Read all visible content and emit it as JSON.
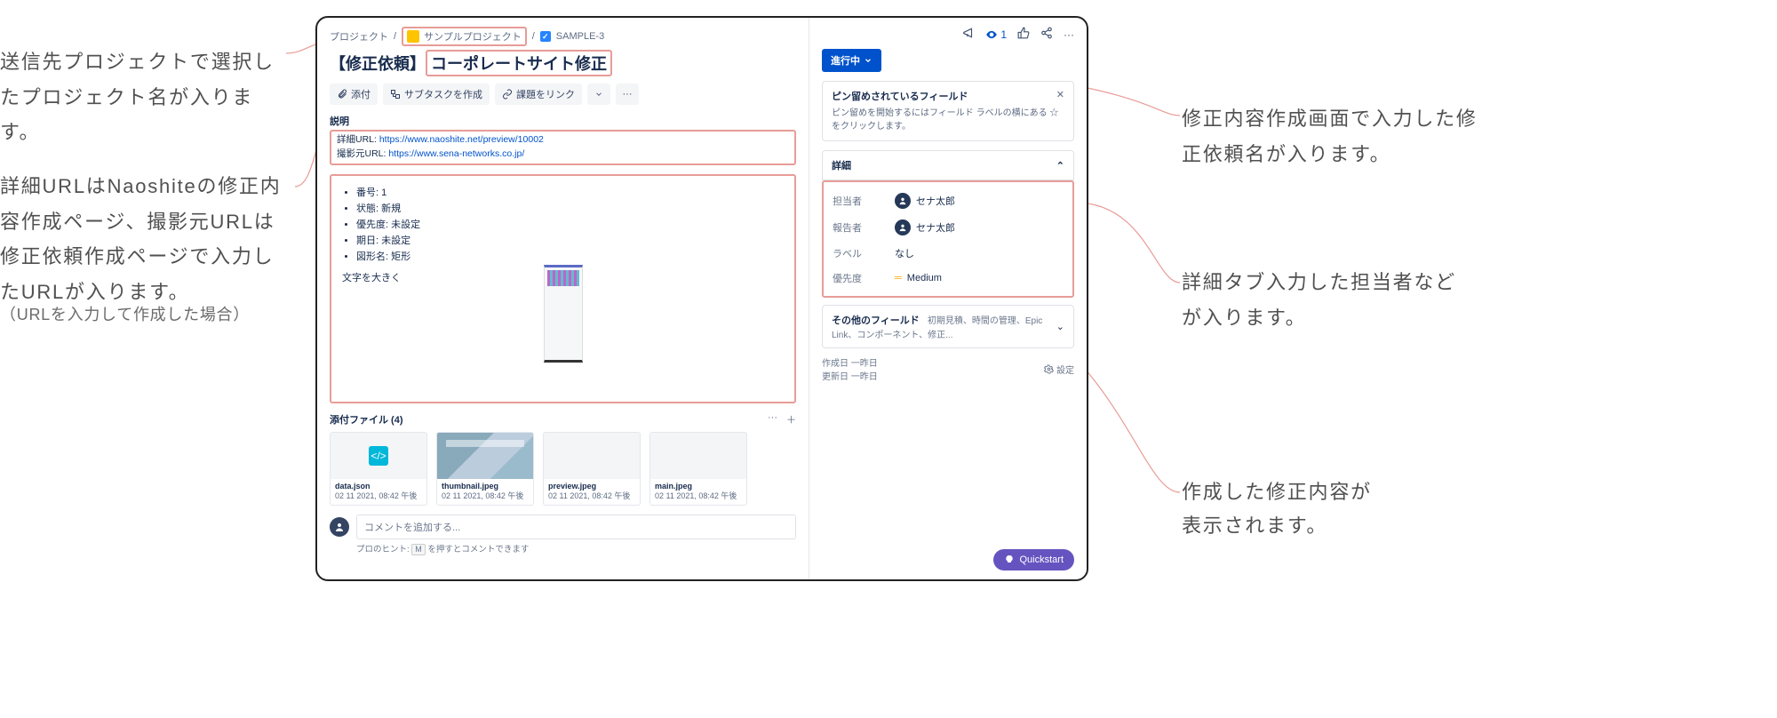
{
  "annotations": {
    "left1": "送信先プロジェクトで選択したプロジェクト名が入ります。",
    "left2a": "詳細URLはNaoshiteの修正内容作成ページ、撮影元URLは修正依頼作成ページで入力したURLが入ります。",
    "left2b": "（URLを入力して作成した場合）",
    "right1": "修正内容作成画面で入力した修正依頼名が入ります。",
    "right2": "詳細タブ入力した担当者などが入ります。",
    "right3a": "作成した修正内容が",
    "right3b": "表示されます。"
  },
  "breadcrumbs": {
    "projects": "プロジェクト",
    "project_name": "サンプルプロジェクト",
    "issue_key": "SAMPLE-3"
  },
  "title": {
    "prefix": "【修正依頼】",
    "name": "コーポレートサイト修正"
  },
  "toolbar": {
    "attach": "添付",
    "subtask": "サブタスクを作成",
    "link": "課題をリンク"
  },
  "desc": {
    "label": "説明",
    "detail_url_label": "詳細URL: ",
    "detail_url": "https://www.naoshite.net/preview/10002",
    "source_url_label": "撮影元URL: ",
    "source_url": "https://www.sena-networks.co.jp/",
    "bullets": {
      "num": "番号: 1",
      "status": "状態: 新規",
      "priority": "優先度: 未設定",
      "due": "期日: 未設定",
      "shape": "図形名: 矩形"
    },
    "enlarge": "文字を大きく"
  },
  "attachments": {
    "header": "添付ファイル (4)",
    "items": [
      {
        "name": "data.json",
        "date": "02 11 2021, 08:42 午後",
        "kind": "json"
      },
      {
        "name": "thumbnail.jpeg",
        "date": "02 11 2021, 08:42 午後",
        "kind": "img"
      },
      {
        "name": "preview.jpeg",
        "date": "02 11 2021, 08:42 午後",
        "kind": "img"
      },
      {
        "name": "main.jpeg",
        "date": "02 11 2021, 08:42 午後",
        "kind": "blank"
      }
    ]
  },
  "comment": {
    "placeholder": "コメントを追加する...",
    "tip_prefix": "プロのヒント: ",
    "tip_key": "M",
    "tip_suffix": " を押すとコメントできます"
  },
  "side": {
    "watch_count": "1",
    "status": "進行中",
    "pin_title": "ピン留めされているフィールド",
    "pin_text": "ピン留めを開始するにはフィールド ラベルの横にある ☆ をクリックします。",
    "detail_header": "詳細",
    "fields": {
      "assignee_label": "担当者",
      "assignee_value": "セナ太郎",
      "reporter_label": "報告者",
      "reporter_value": "セナ太郎",
      "labels_label": "ラベル",
      "labels_value": "なし",
      "priority_label": "優先度",
      "priority_value": "Medium"
    },
    "other_fields_label": "その他のフィールド",
    "other_fields_hint": "初期見積、時間の管理、Epic Link、コンポーネント、修正...",
    "created": "作成日 一昨日",
    "updated": "更新日 一昨日",
    "configure": "設定",
    "quickstart": "Quickstart"
  }
}
